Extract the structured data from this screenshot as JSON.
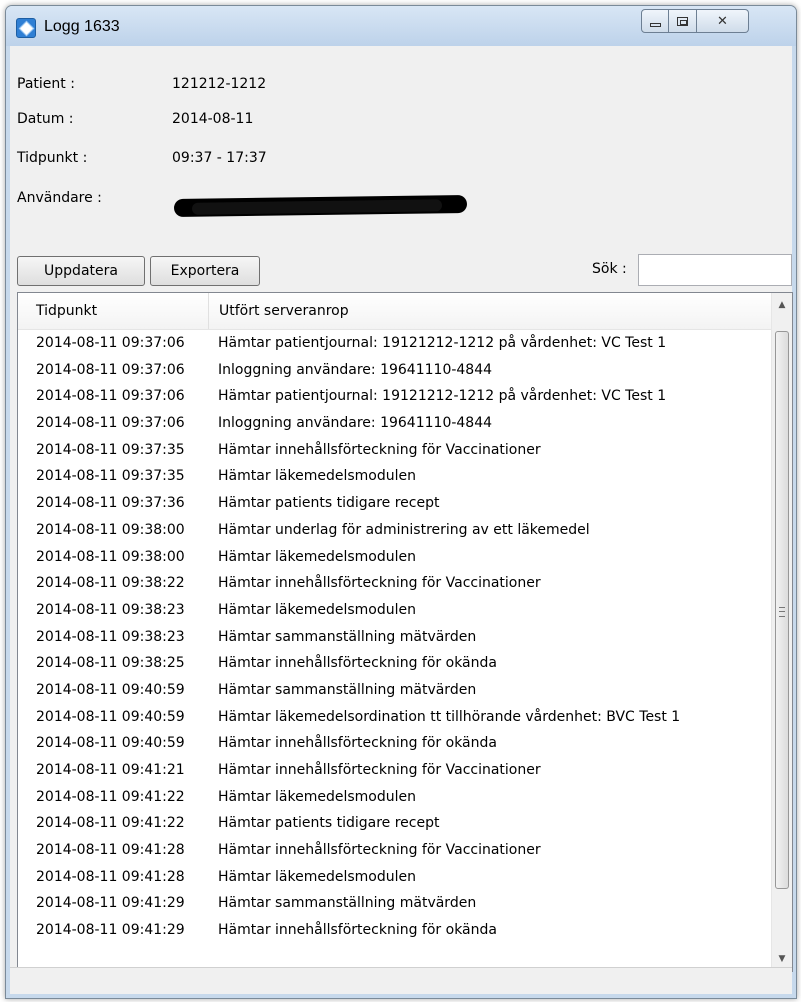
{
  "window": {
    "title": "Logg 1633",
    "controls": {
      "minimize": "",
      "maximize": "",
      "close": "✕"
    }
  },
  "info": {
    "patient_label": "Patient :",
    "patient_value": "121212-1212",
    "datum_label": "Datum :",
    "datum_value": "2014-08-11",
    "tidpunkt_label": "Tidpunkt :",
    "tidpunkt_value": "09:37 - 17:37",
    "user_label": "Användare :"
  },
  "toolbar": {
    "update_label": "Uppdatera",
    "export_label": "Exportera",
    "search_label": "Sök :",
    "search_value": ""
  },
  "table": {
    "columns": [
      "Tidpunkt",
      "Utfört serveranrop"
    ],
    "rows": [
      [
        "2014-08-11 09:37:06",
        "Hämtar patientjournal: 19121212-1212 på vårdenhet: VC Test 1"
      ],
      [
        "2014-08-11 09:37:06",
        "Inloggning användare: 19641110-4844"
      ],
      [
        "2014-08-11 09:37:06",
        "Hämtar patientjournal: 19121212-1212 på vårdenhet: VC Test 1"
      ],
      [
        "2014-08-11 09:37:06",
        "Inloggning användare: 19641110-4844"
      ],
      [
        "2014-08-11 09:37:35",
        "Hämtar innehållsförteckning för Vaccinationer"
      ],
      [
        "2014-08-11 09:37:35",
        "Hämtar läkemedelsmodulen"
      ],
      [
        "2014-08-11 09:37:36",
        "Hämtar patients tidigare recept"
      ],
      [
        "2014-08-11 09:38:00",
        "Hämtar underlag för administrering av ett läkemedel"
      ],
      [
        "2014-08-11 09:38:00",
        "Hämtar läkemedelsmodulen"
      ],
      [
        "2014-08-11 09:38:22",
        "Hämtar innehållsförteckning för Vaccinationer"
      ],
      [
        "2014-08-11 09:38:23",
        "Hämtar läkemedelsmodulen"
      ],
      [
        "2014-08-11 09:38:23",
        "Hämtar sammanställning mätvärden"
      ],
      [
        "2014-08-11 09:38:25",
        "Hämtar innehållsförteckning för okända"
      ],
      [
        "2014-08-11 09:40:59",
        "Hämtar sammanställning mätvärden"
      ],
      [
        "2014-08-11 09:40:59",
        "Hämtar läkemedelsordination tt tillhörande vårdenhet: BVC Test 1"
      ],
      [
        "2014-08-11 09:40:59",
        "Hämtar innehållsförteckning för okända"
      ],
      [
        "2014-08-11 09:41:21",
        "Hämtar innehållsförteckning för Vaccinationer"
      ],
      [
        "2014-08-11 09:41:22",
        "Hämtar läkemedelsmodulen"
      ],
      [
        "2014-08-11 09:41:22",
        "Hämtar patients tidigare recept"
      ],
      [
        "2014-08-11 09:41:28",
        "Hämtar innehållsförteckning för Vaccinationer"
      ],
      [
        "2014-08-11 09:41:28",
        "Hämtar läkemedelsmodulen"
      ],
      [
        "2014-08-11 09:41:29",
        "Hämtar sammanställning mätvärden"
      ],
      [
        "2014-08-11 09:41:29",
        "Hämtar innehållsförteckning för okända"
      ]
    ]
  },
  "scrollbar": {
    "up": "▲",
    "down": "▼"
  },
  "colors": {
    "accent": "#2f7fd4",
    "frame": "#c7d9ec"
  }
}
